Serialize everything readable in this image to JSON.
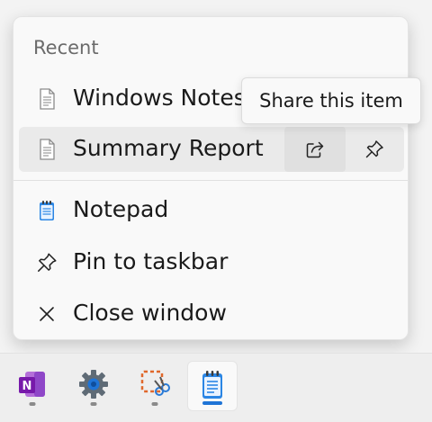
{
  "jumplist": {
    "section_label": "Recent",
    "recent_items": [
      {
        "label": "Windows Notes"
      },
      {
        "label": "Summary Report"
      }
    ],
    "tasks": [
      {
        "label": "Notepad"
      },
      {
        "label": "Pin to taskbar"
      },
      {
        "label": "Close window"
      }
    ]
  },
  "tooltip": {
    "text": "Share this item"
  },
  "icons": {
    "document": "document-icon",
    "share": "share-icon",
    "pin": "pin-icon",
    "notepad": "notepad-icon",
    "close": "close-icon"
  },
  "taskbar": {
    "apps": [
      {
        "icon": "onenote-icon"
      },
      {
        "icon": "settings-gear-icon"
      },
      {
        "icon": "snipping-tool-icon"
      },
      {
        "icon": "notepad-icon",
        "active": true
      }
    ]
  },
  "colors": {
    "accent": "#1f74d6"
  }
}
